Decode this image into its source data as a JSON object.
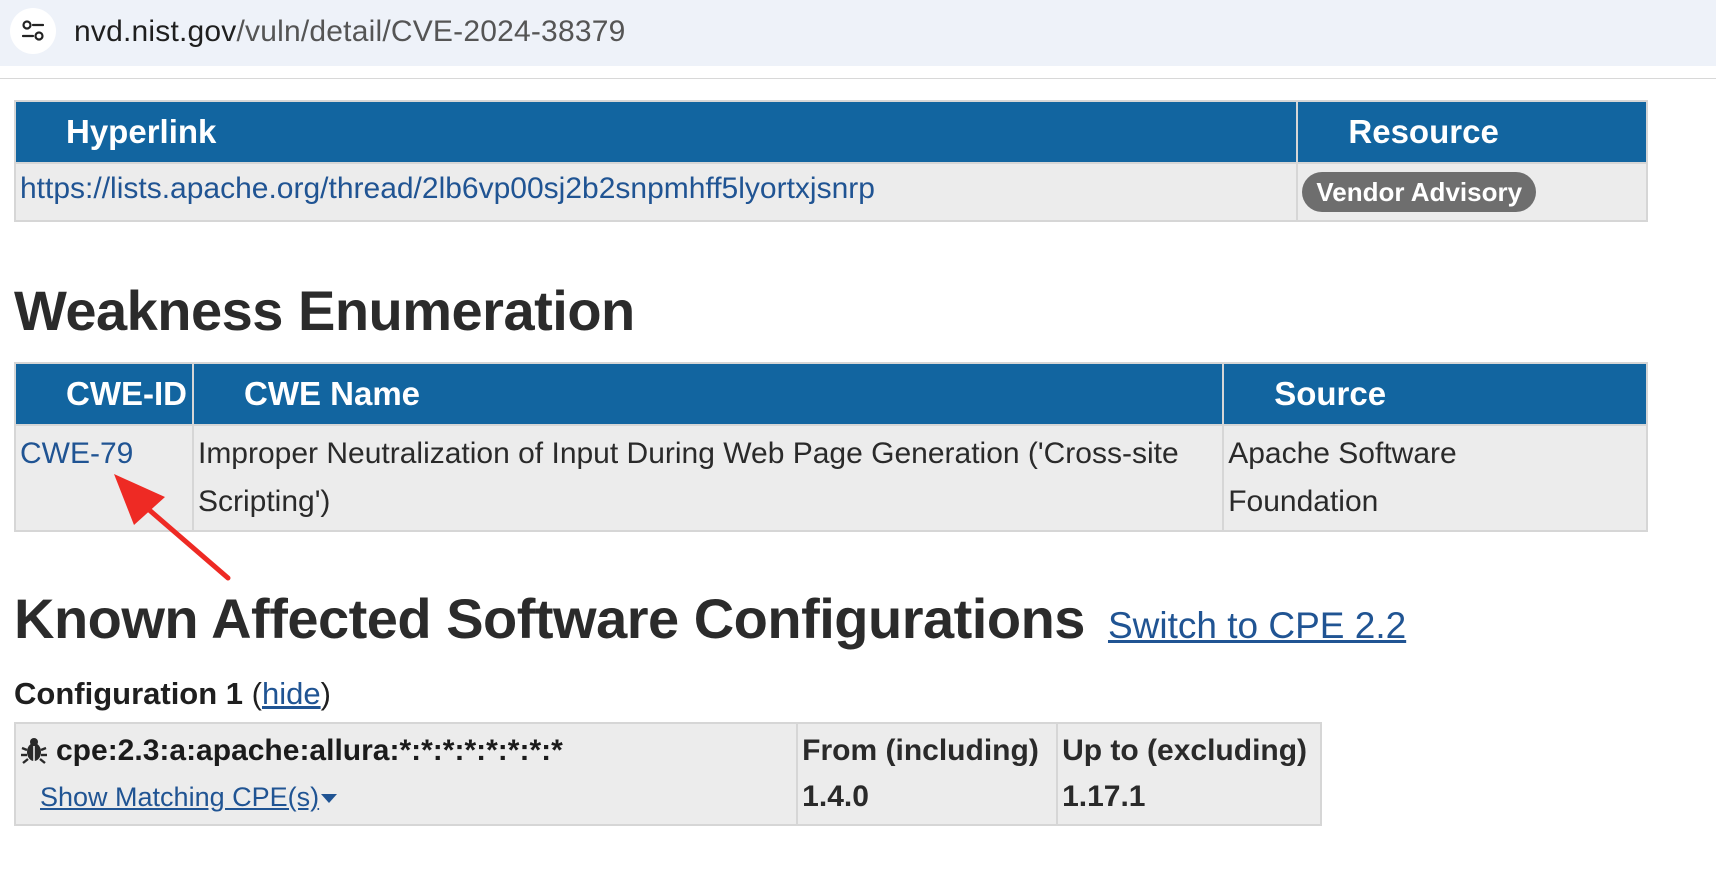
{
  "browser": {
    "url_host": "nvd.nist.gov",
    "url_path": "/vuln/detail/CVE-2024-38379",
    "site_info_icon": "tune-icon"
  },
  "references": {
    "headers": {
      "hyperlink": "Hyperlink",
      "resource": "Resource"
    },
    "rows": [
      {
        "hyperlink": "https://lists.apache.org/thread/2lb6vp00sj2b2snpmhff5lyortxjsnrp",
        "resource": "Vendor Advisory"
      }
    ]
  },
  "weakness": {
    "title": "Weakness Enumeration",
    "headers": {
      "cwe_id": "CWE-ID",
      "cwe_name": "CWE Name",
      "source": "Source"
    },
    "rows": [
      {
        "cwe_id": "CWE-79",
        "cwe_name": "Improper Neutralization of Input During Web Page Generation ('Cross-site Scripting')",
        "source": "Apache Software Foundation"
      }
    ]
  },
  "configurations": {
    "title": "Known Affected Software Configurations",
    "switch_link": "Switch to CPE 2.2",
    "config_label": "Configuration 1",
    "paren_open": "(",
    "hide_link": "hide",
    "paren_close": ")",
    "rows": [
      {
        "cpe": "cpe:2.3:a:apache:allura:*:*:*:*:*:*:*:*",
        "show_matching": "Show Matching CPE(s)",
        "from_label": "From (including)",
        "from_value": "1.4.0",
        "upto_label": "Up to (excluding)",
        "upto_value": "1.17.1"
      }
    ]
  },
  "annotation": {
    "arrow_color": "#ee2a24"
  },
  "colors": {
    "header_blue": "#1265a0",
    "link_blue": "#205493",
    "badge_gray": "#6e6e6e",
    "cell_bg": "#ececec"
  }
}
